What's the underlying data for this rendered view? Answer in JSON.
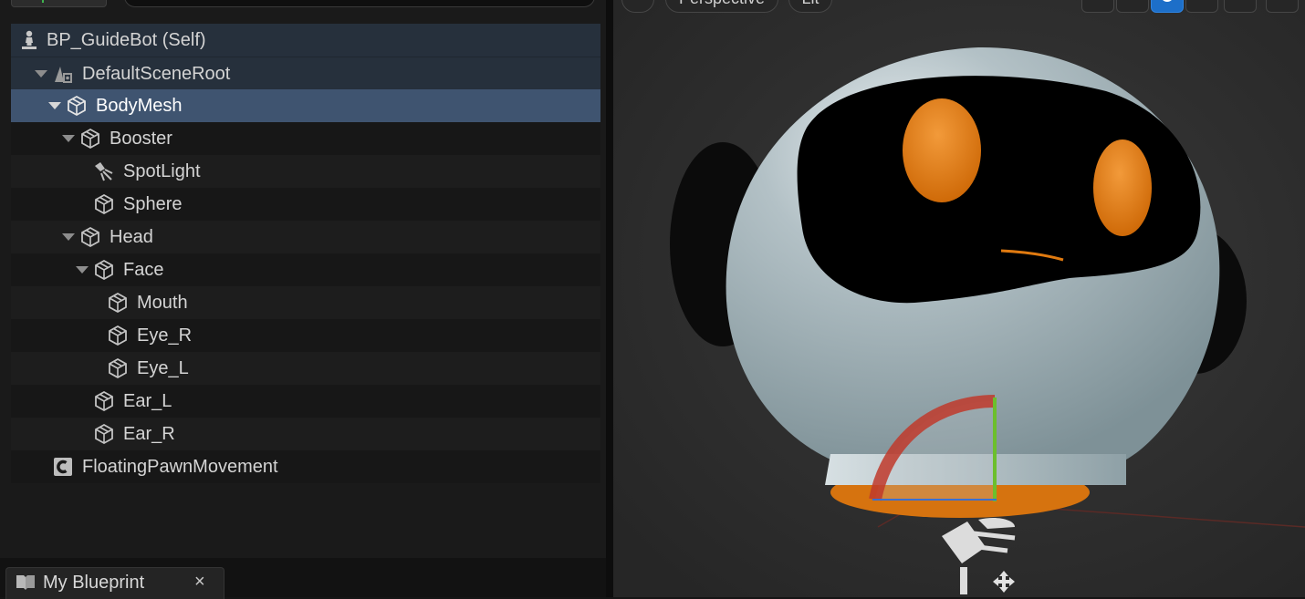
{
  "toolbar": {
    "search_placeholder": ""
  },
  "tree": {
    "items": [
      {
        "label": "BP_GuideBot (Self)",
        "icon": "actor-icon",
        "state": "ancestor"
      },
      {
        "label": "DefaultSceneRoot",
        "icon": "scene-root-icon",
        "state": "ancestor"
      },
      {
        "label": "BodyMesh",
        "icon": "static-mesh-icon",
        "state": "selected"
      },
      {
        "label": "Booster",
        "icon": "static-mesh-icon"
      },
      {
        "label": "SpotLight",
        "icon": "spot-light-icon"
      },
      {
        "label": "Sphere",
        "icon": "static-mesh-icon"
      },
      {
        "label": "Head",
        "icon": "static-mesh-icon"
      },
      {
        "label": "Face",
        "icon": "static-mesh-icon"
      },
      {
        "label": "Mouth",
        "icon": "static-mesh-icon"
      },
      {
        "label": "Eye_R",
        "icon": "static-mesh-icon"
      },
      {
        "label": "Eye_L",
        "icon": "static-mesh-icon"
      },
      {
        "label": "Ear_L",
        "icon": "static-mesh-icon"
      },
      {
        "label": "Ear_R",
        "icon": "static-mesh-icon"
      },
      {
        "label": "FloatingPawnMovement",
        "icon": "movement-component-icon"
      }
    ]
  },
  "bottom_tab": {
    "label": "My Blueprint",
    "close": "×"
  },
  "viewport": {
    "view_mode": "Perspective",
    "lighting": "Lit",
    "active_tool": "rotate",
    "colors": {
      "body": "#9fb0b6",
      "visor": "#000000",
      "eyes": "#e2780e",
      "booster": "#d6730f",
      "gizmo_x": "#c0392b",
      "gizmo_y": "#6cbf2c"
    }
  }
}
